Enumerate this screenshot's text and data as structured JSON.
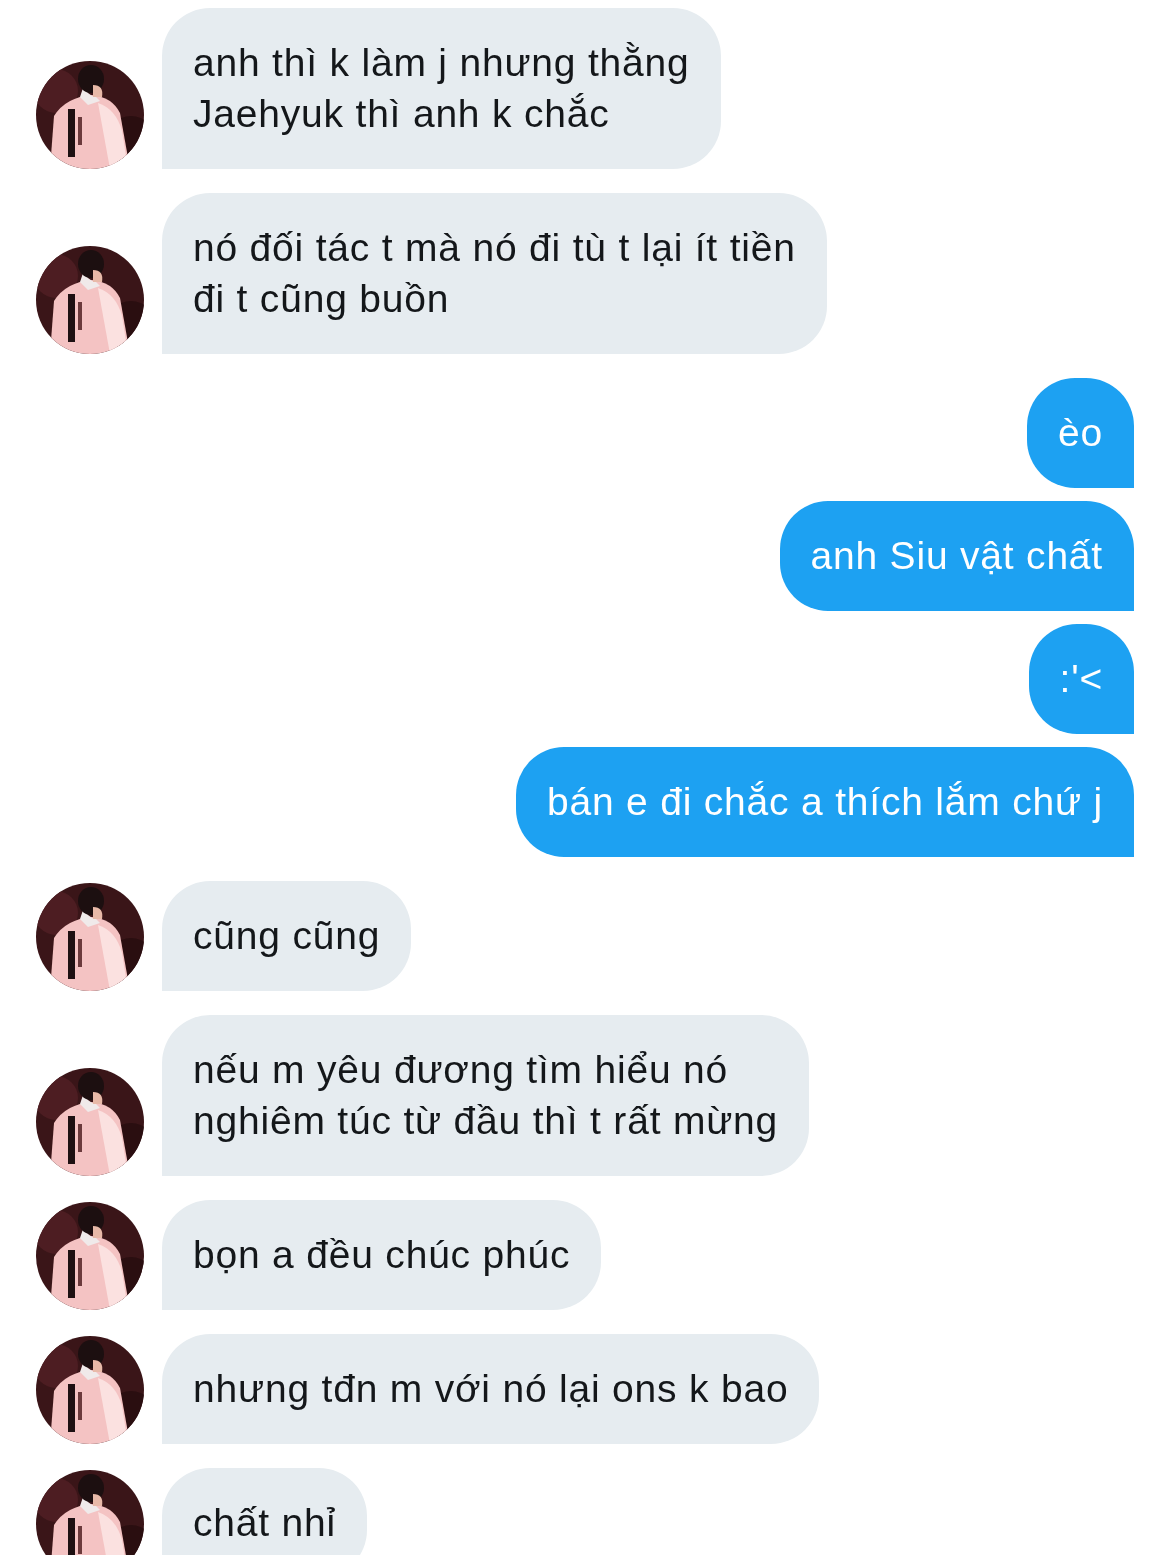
{
  "messages": [
    {
      "kind": "incoming",
      "text": "anh thì k làm j nhưng thằng\nJaehyuk thì anh k chắc"
    },
    {
      "kind": "incoming",
      "text": "nó đối tác t mà nó đi tù t lại ít tiền\nđi t cũng buồn"
    },
    {
      "kind": "outgoing",
      "text": "èo"
    },
    {
      "kind": "outgoing",
      "text": "anh Siu vật chất"
    },
    {
      "kind": "outgoing",
      "text": ":'<"
    },
    {
      "kind": "outgoing",
      "text": "bán e đi chắc a thích lắm chứ j"
    },
    {
      "kind": "incoming",
      "text": "cũng cũng"
    },
    {
      "kind": "incoming",
      "text": "nếu m yêu đương tìm hiểu nó\nnghiêm túc từ đầu thì t rất mừng"
    },
    {
      "kind": "incoming",
      "text": "bọn a đều chúc phúc"
    },
    {
      "kind": "incoming",
      "text": "nhưng tđn m với nó lại ons k bao"
    },
    {
      "kind": "incoming",
      "text": "chất nhỉ"
    }
  ]
}
